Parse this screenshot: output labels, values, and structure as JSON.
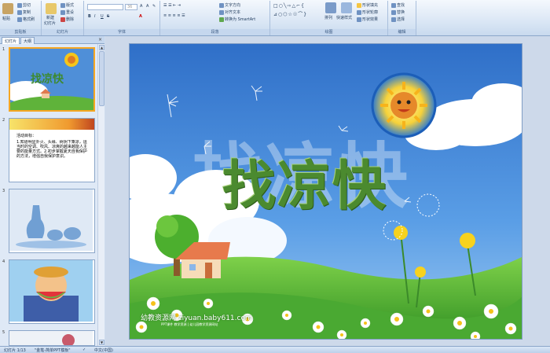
{
  "ribbon": {
    "clipboard": {
      "paste": "粘贴",
      "cut": "剪切",
      "copy": "复制",
      "format_painter": "格式刷",
      "label": "剪贴板"
    },
    "slides": {
      "new_slide": "新建",
      "new_slide2": "幻灯片",
      "layout": "版式",
      "reset": "重设",
      "delete": "删除",
      "label": "幻灯片"
    },
    "font": {
      "size": "36",
      "bold": "B",
      "italic": "I",
      "underline": "U",
      "strike": "S",
      "label": "字体"
    },
    "paragraph": {
      "text_direction": "文字方向",
      "align_text": "对齐文本",
      "smartart": "转换为 SmartArt",
      "label": "段落"
    },
    "drawing": {
      "arrange": "排列",
      "quick_styles": "快速样式",
      "shape_fill": "形状填充",
      "shape_outline": "形状轮廓",
      "shape_effects": "形状效果",
      "label": "绘图"
    },
    "editing": {
      "find": "查找",
      "replace": "替换",
      "select": "选择",
      "label": "编辑"
    }
  },
  "panel": {
    "tab_slides": "幻灯片",
    "tab_outline": "大纲",
    "close": "×"
  },
  "thumbs": [
    {
      "num": "1",
      "title": "找凉快"
    },
    {
      "num": "2",
      "heading": "活动目标：",
      "body": "1.知道明显扑火、头缘、树阴下乘凉，运当时的空调、吹风、凉爽的越来越能人主要的能量方式。2.初步掌握夏天自我保护的方法，增强自我保护意识。"
    },
    {
      "num": "3"
    },
    {
      "num": "4"
    },
    {
      "num": "5"
    }
  ],
  "slide": {
    "title": "找凉快",
    "watermark_main": "幼教资源网 ziyuan.baby611.com",
    "watermark_sub": "PPT课件 教学资源 | 幼儿园教学资源网站"
  },
  "status": {
    "slide_info": "幻灯片 1/13",
    "theme": "\"金笔-简单PPT模板\"",
    "language": "中文(中国)"
  }
}
